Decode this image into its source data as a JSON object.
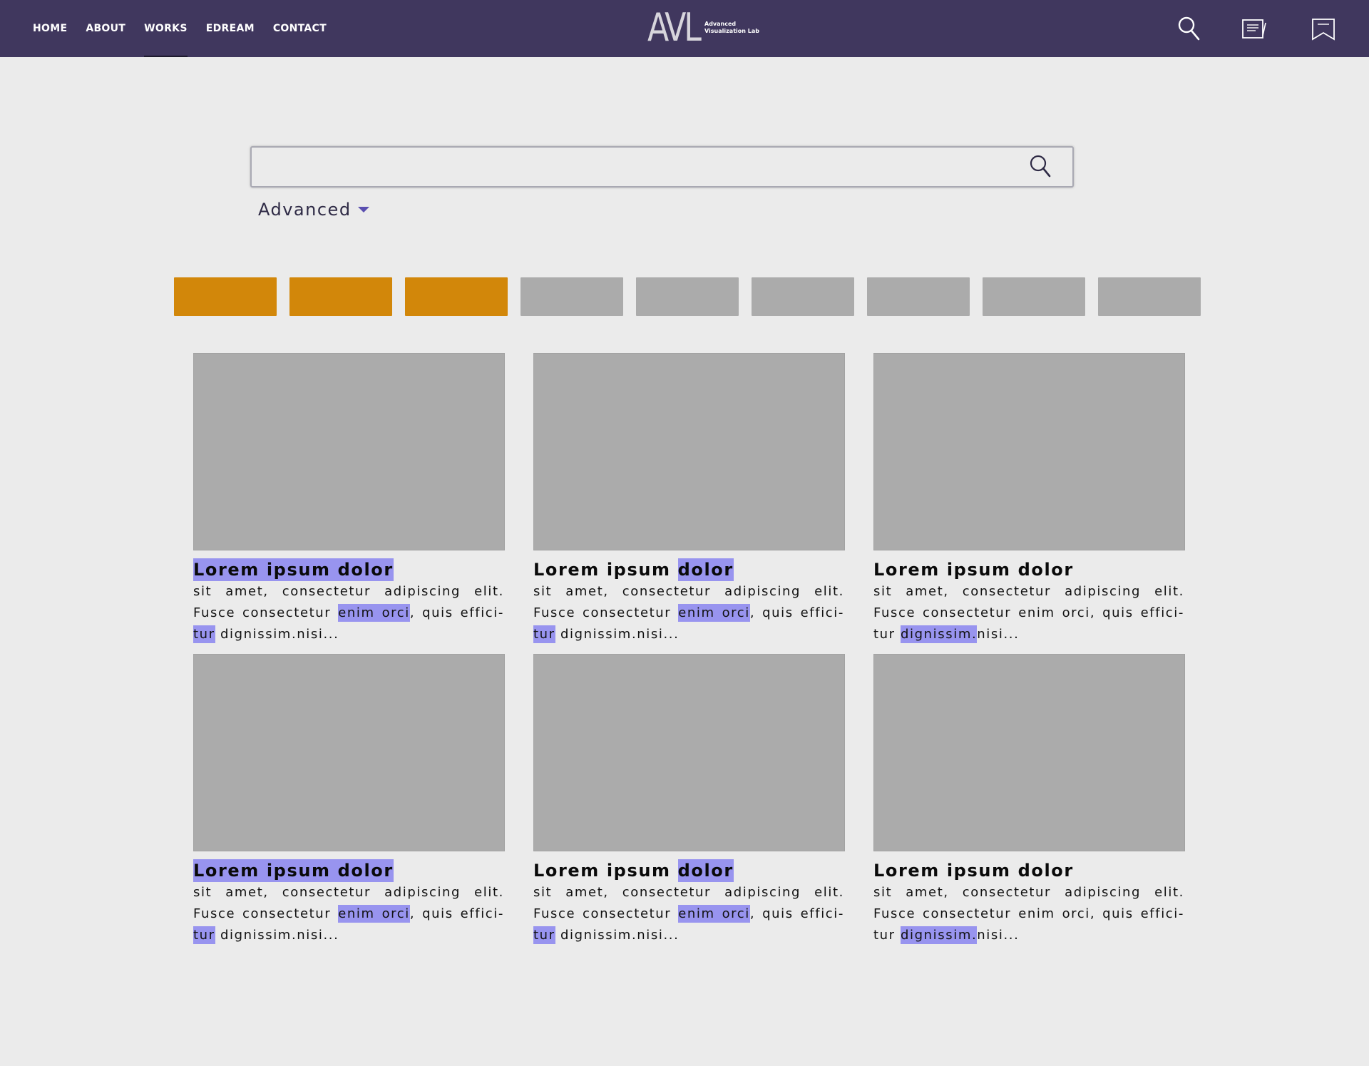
{
  "header": {
    "nav": [
      {
        "label": "HOME"
      },
      {
        "label": "ABOUT"
      },
      {
        "label": "WORKS"
      },
      {
        "label": "EDREAM"
      },
      {
        "label": "CONTACT"
      }
    ],
    "active_nav": "WORKS",
    "logo": {
      "main": "AVL",
      "line1": "Advanced",
      "line2": "Visualization Lab"
    },
    "icons": [
      "search-icon",
      "notes-icon",
      "bookmark-icon"
    ]
  },
  "search": {
    "value": "",
    "placeholder": ""
  },
  "advanced": {
    "label": "Advanced"
  },
  "filters": [
    {
      "state": "active",
      "color": "#d2870a"
    },
    {
      "state": "active",
      "color": "#d2870a"
    },
    {
      "state": "active",
      "color": "#d2870a"
    },
    {
      "state": "inactive",
      "color": "#ababab"
    },
    {
      "state": "inactive",
      "color": "#ababab"
    },
    {
      "state": "inactive",
      "color": "#ababab"
    },
    {
      "state": "inactive",
      "color": "#ababab"
    },
    {
      "state": "inactive",
      "color": "#ababab"
    },
    {
      "state": "inactive",
      "color": "#ababab"
    }
  ],
  "colors": {
    "header": "#40375e",
    "highlight": "#9894ef",
    "accent": "#d2870a",
    "placeholder": "#ababab"
  },
  "cards": [
    {
      "title": [
        {
          "t": "Lorem ipsum dolor",
          "h": true
        }
      ],
      "body": [
        {
          "t": "sit amet, consectetur adipiscing elit. Fusce consectetur ",
          "h": false
        },
        {
          "t": "enim orci",
          "h": true
        },
        {
          "t": ", quis effici-",
          "h": false
        },
        {
          "t": "tur",
          "h": true
        },
        {
          "t": " dignissim.nisi...",
          "h": false
        }
      ]
    },
    {
      "title": [
        {
          "t": "Lorem ipsum ",
          "h": false
        },
        {
          "t": "dolor",
          "h": true
        }
      ],
      "body": [
        {
          "t": "sit amet, consectetur adipiscing elit. Fusce consectetur ",
          "h": false
        },
        {
          "t": "enim orci",
          "h": true
        },
        {
          "t": ", quis effici-",
          "h": false
        },
        {
          "t": "tur",
          "h": true
        },
        {
          "t": " dignissim.nisi...",
          "h": false
        }
      ]
    },
    {
      "title": [
        {
          "t": "Lorem ipsum dolor",
          "h": false
        }
      ],
      "body": [
        {
          "t": "sit amet, consectetur adipiscing elit. Fusce consectetur enim orci, quis effici- tur ",
          "h": false
        },
        {
          "t": "dignissim.",
          "h": true
        },
        {
          "t": "nisi...",
          "h": false
        }
      ]
    },
    {
      "title": [
        {
          "t": "Lorem ipsum dolor",
          "h": true
        }
      ],
      "body": [
        {
          "t": "sit amet, consectetur adipiscing elit. Fusce consectetur ",
          "h": false
        },
        {
          "t": "enim orci",
          "h": true
        },
        {
          "t": ", quis effici-",
          "h": false
        },
        {
          "t": "tur",
          "h": true
        },
        {
          "t": " dignissim.nisi...",
          "h": false
        }
      ]
    },
    {
      "title": [
        {
          "t": "Lorem ipsum ",
          "h": false
        },
        {
          "t": "dolor",
          "h": true
        }
      ],
      "body": [
        {
          "t": "sit amet, consectetur adipiscing elit. Fusce consectetur ",
          "h": false
        },
        {
          "t": "enim orci",
          "h": true
        },
        {
          "t": ", quis effici-",
          "h": false
        },
        {
          "t": "tur",
          "h": true
        },
        {
          "t": " dignissim.nisi...",
          "h": false
        }
      ]
    },
    {
      "title": [
        {
          "t": "Lorem ipsum dolor",
          "h": false
        }
      ],
      "body": [
        {
          "t": "sit amet, consectetur adipiscing elit. Fusce consectetur enim orci, quis effici- tur ",
          "h": false
        },
        {
          "t": "dignissim.",
          "h": true
        },
        {
          "t": "nisi...",
          "h": false
        }
      ]
    }
  ]
}
